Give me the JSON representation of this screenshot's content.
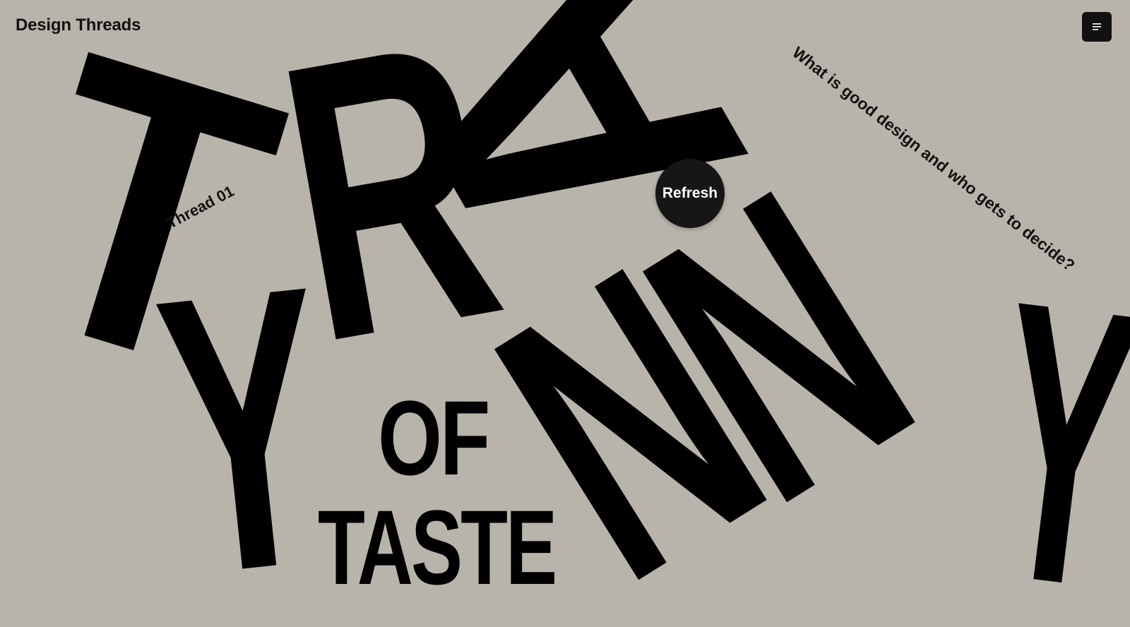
{
  "header": {
    "brand": "Design Threads",
    "menu_icon": "menu-icon"
  },
  "hero": {
    "thread_label": "Thread 01",
    "question": "What is good design and who gets to decide?",
    "refresh_label": "Refresh",
    "title_letters": {
      "t": "T",
      "r": "R",
      "a": "A",
      "y1": "Y",
      "n1": "N",
      "n2": "N",
      "y2": "Y"
    },
    "subtitle_of": "OF",
    "subtitle_taste": "TASTE"
  },
  "colors": {
    "background": "#b9b4ab",
    "ink": "#000000",
    "button": "#161616"
  }
}
